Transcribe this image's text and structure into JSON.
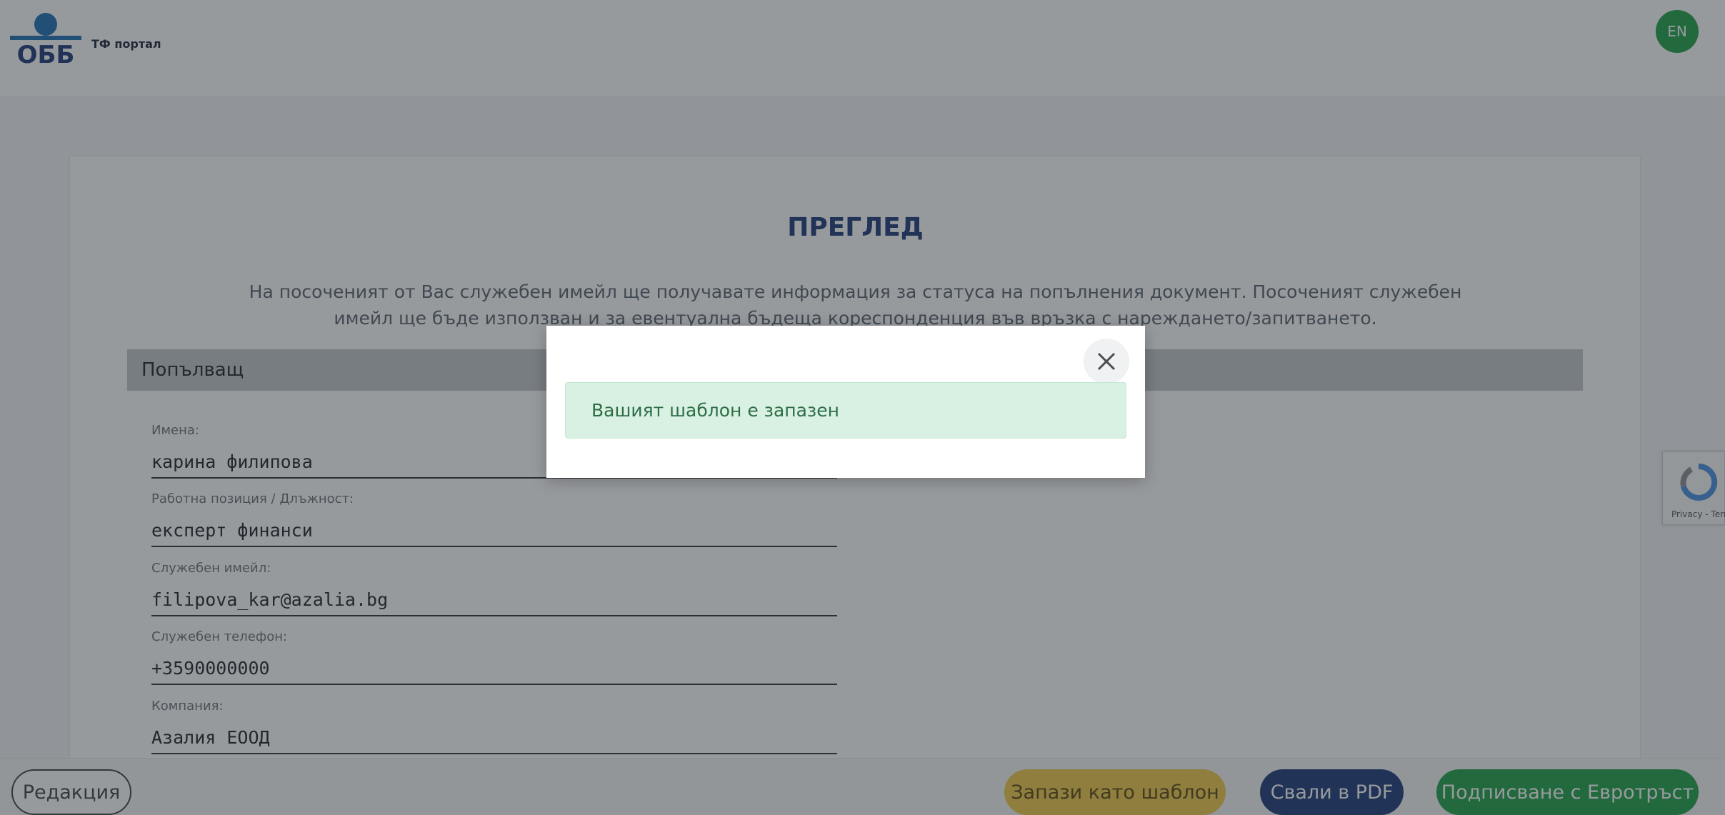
{
  "header": {
    "logo_alt": "ОББ",
    "portal_label": "ТФ портал",
    "language_button": "EN"
  },
  "page": {
    "title": "ПРЕГЛЕД",
    "intro": "На посоченият от Вас служебен имейл ще получавате информация за статуса на попълнения документ. Посоченият служебен имейл ще бъде използван и за евентуална бъдеща кореспонденция във връзка с нареждането/запитването."
  },
  "filler_section": {
    "heading": "Попълващ",
    "fields": [
      {
        "label": "Имена:",
        "value": "карина филипова"
      },
      {
        "label": "Работна позиция / Длъжност:",
        "value": "експерт финанси"
      },
      {
        "label": "Служебен имейл:",
        "value": "filipova_kar@azalia.bg"
      },
      {
        "label": "Служебен телефон:",
        "value": "+3590000000"
      },
      {
        "label": "Компания:",
        "value": "Азалия ЕООД"
      }
    ]
  },
  "recaptcha": {
    "text": "Privacy - Terms"
  },
  "footer": {
    "edit_label": "Редакция",
    "save_template_label": "Запази като шаблон",
    "download_pdf_label": "Свали в PDF",
    "sign_label": "Подписване с Евротръст"
  },
  "modal": {
    "message": "Вашият шаблон е запазен"
  },
  "colors": {
    "brand_blue": "#1e3a7a",
    "green": "#1fa24a",
    "yellow": "#f2c94c"
  }
}
